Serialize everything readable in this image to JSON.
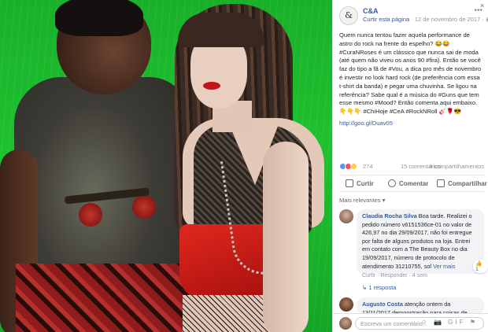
{
  "page": {
    "name": "C&A",
    "avatar_glyph": "&",
    "follow_label": "Curtir esta página",
    "date": "12 de novembro de 2017",
    "privacy_icon": "globe-icon"
  },
  "post": {
    "text": "Quem nunca tentou fazer aquela performance de astro do rock na frente do espelho? 😂😂 #CuraNRoses é um clássico que nunca sai de moda (até quem não viveu os anos 90 #fira). Então se você faz do tipo a fã de #Vou, a dica pro mês de novembro é investir no look hard rock (de preferência com essa t-shirt da banda) e pegar uma chuvinha. Se ligou na referência? Sabe qual é a música do #Guns que tem esse mesmo #Mood? Então comenta aqui embaixo. 👇👇👇 #ChiHoje #CeA #RockNRoll 🎸🌹😎",
    "link": "http://goo.gl/Duav05"
  },
  "reactions": {
    "count": "274",
    "comments": "15 comentários",
    "shares": "4 compartilhamentos",
    "colors": [
      "#5890ff",
      "#f25268",
      "#fbcd51"
    ]
  },
  "actions": {
    "like": "Curtir",
    "comment": "Comentar",
    "share": "Compartilhar"
  },
  "relevance_label": "Mais relevantes ▾",
  "comments": [
    {
      "name": "Claudia Rocha Silva",
      "text": "Boa tarde. Realizei o pedido número v6151536ce-01 no valor de 426,97 no dia 29/09/2017, não foi entregue por falta de alguns produtos na loja. Entrei em contato com a The Beauty Box no dia 19/09/2017, número de protocolo de atendimento 31210755, sol",
      "see_more": "Ver mais",
      "actions": "Curtir · Responder · 4 sem",
      "reaction": "👍 1",
      "replies": "↳ 1 resposta"
    },
    {
      "name": "Augusto Costa",
      "text": "atenção ontem da 13/11/2017 demonstração para coisas de..."
    }
  ],
  "composer": {
    "placeholder": "Escreva um comentário...",
    "icons": "☺ 📷 GIF ⚑"
  },
  "close_glyph": "×"
}
